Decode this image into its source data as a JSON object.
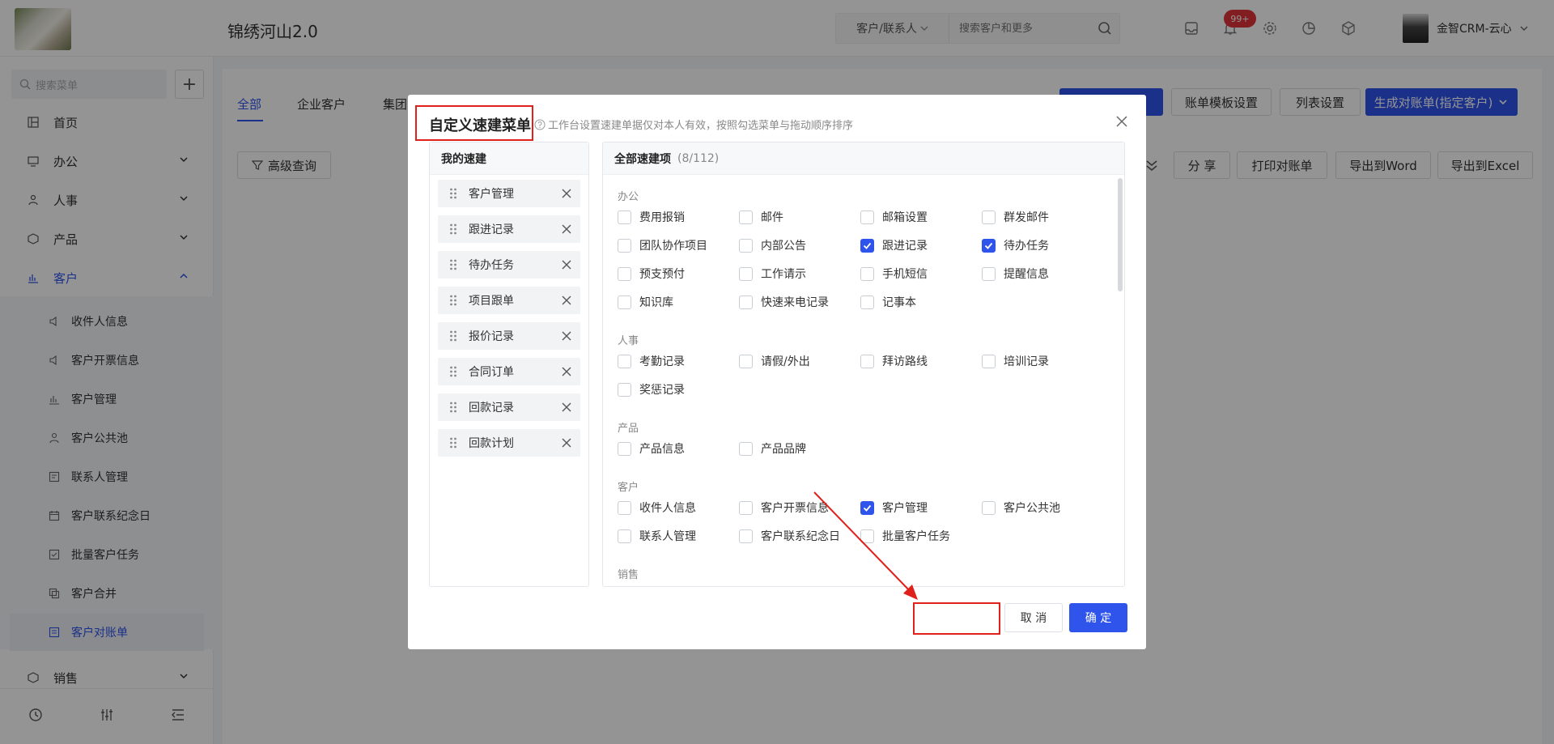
{
  "header": {
    "app_title": "锦绣河山2.0",
    "search_scope": "客户/联系人",
    "search_placeholder": "搜索客户和更多",
    "notification_badge": "99+",
    "user_name": "金智CRM-云心"
  },
  "sidebar": {
    "search_placeholder": "搜索菜单",
    "items": [
      {
        "label": "首页",
        "icon": "grid-icon"
      },
      {
        "label": "办公",
        "icon": "monitor-icon"
      },
      {
        "label": "人事",
        "icon": "people-icon"
      },
      {
        "label": "产品",
        "icon": "box-icon"
      },
      {
        "label": "客户",
        "icon": "chart-icon"
      }
    ],
    "sub_items": [
      {
        "label": "收件人信息",
        "icon": "speaker-icon"
      },
      {
        "label": "客户开票信息",
        "icon": "speaker-icon"
      },
      {
        "label": "客户管理",
        "icon": "bar-chart-icon"
      },
      {
        "label": "客户公共池",
        "icon": "user-icon"
      },
      {
        "label": "联系人管理",
        "icon": "contact-card-icon"
      },
      {
        "label": "客户联系纪念日",
        "icon": "calendar-icon"
      },
      {
        "label": "批量客户任务",
        "icon": "task-icon"
      },
      {
        "label": "客户合并",
        "icon": "merge-icon"
      },
      {
        "label": "客户对账单",
        "icon": "statement-icon"
      }
    ],
    "sales_label": "销售"
  },
  "main": {
    "tabs": [
      "全部",
      "企业客户",
      "集团"
    ],
    "filter_button": "高级查询",
    "toolbar_top": [
      "账单模板设置",
      "列表设置",
      "生成对账单(指定客户)"
    ],
    "toolbar_second": [
      "分 享",
      "打印对账单",
      "导出到Word",
      "导出到Excel"
    ]
  },
  "dialog": {
    "title": "自定义速建菜单",
    "hint": "工作台设置速建单据仅对本人有效，按照勾选菜单与拖动顺序排序",
    "left_title": "我的速建",
    "my_items": [
      "客户管理",
      "跟进记录",
      "待办任务",
      "项目跟单",
      "报价记录",
      "合同订单",
      "回款记录",
      "回款计划"
    ],
    "right_title": "全部速建项",
    "right_count": "(8/112)",
    "sections": [
      {
        "label": "办公",
        "options": [
          {
            "label": "费用报销",
            "checked": false
          },
          {
            "label": "邮件",
            "checked": false
          },
          {
            "label": "邮箱设置",
            "checked": false
          },
          {
            "label": "群发邮件",
            "checked": false
          },
          {
            "label": "团队协作项目",
            "checked": false
          },
          {
            "label": "内部公告",
            "checked": false
          },
          {
            "label": "跟进记录",
            "checked": true
          },
          {
            "label": "待办任务",
            "checked": true
          },
          {
            "label": "预支预付",
            "checked": false
          },
          {
            "label": "工作请示",
            "checked": false
          },
          {
            "label": "手机短信",
            "checked": false
          },
          {
            "label": "提醒信息",
            "checked": false
          },
          {
            "label": "知识库",
            "checked": false
          },
          {
            "label": "快速来电记录",
            "checked": false
          },
          {
            "label": "记事本",
            "checked": false
          }
        ]
      },
      {
        "label": "人事",
        "options": [
          {
            "label": "考勤记录",
            "checked": false
          },
          {
            "label": "请假/外出",
            "checked": false
          },
          {
            "label": "拜访路线",
            "checked": false
          },
          {
            "label": "培训记录",
            "checked": false
          },
          {
            "label": "奖惩记录",
            "checked": false
          }
        ]
      },
      {
        "label": "产品",
        "options": [
          {
            "label": "产品信息",
            "checked": false
          },
          {
            "label": "产品品牌",
            "checked": false
          }
        ]
      },
      {
        "label": "客户",
        "options": [
          {
            "label": "收件人信息",
            "checked": false
          },
          {
            "label": "客户开票信息",
            "checked": false
          },
          {
            "label": "客户管理",
            "checked": true
          },
          {
            "label": "客户公共池",
            "checked": false
          },
          {
            "label": "联系人管理",
            "checked": false
          },
          {
            "label": "客户联系纪念日",
            "checked": false
          },
          {
            "label": "批量客户任务",
            "checked": false
          }
        ]
      },
      {
        "label": "销售",
        "options": []
      }
    ],
    "cancel_label": "取 消",
    "ok_label": "确 定"
  },
  "colors": {
    "accent": "#2f54eb",
    "annotation": "#e0201b",
    "badge": "#e0333a"
  }
}
